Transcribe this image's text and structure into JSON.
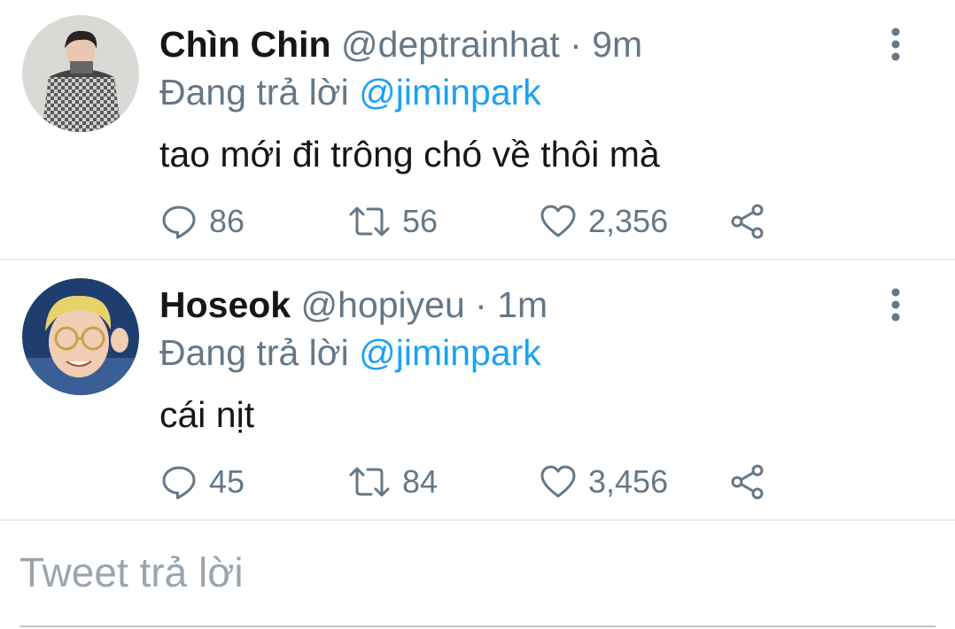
{
  "tweets": [
    {
      "display_name": "Chìn Chin",
      "handle": "@deptrainhat",
      "separator": " · ",
      "time": "9m",
      "replying_prefix": "Đang trả lời ",
      "replying_to": "@jiminpark",
      "text": "tao mới đi trông chó về thôi mà",
      "replies": "86",
      "retweets": "56",
      "likes": "2,356",
      "avatar_colors": {
        "bg": "#d9d9d6",
        "coat": "#3c3c3c",
        "hair": "#2a2220",
        "skin": "#e9c8b2"
      }
    },
    {
      "display_name": "Hoseok",
      "handle": "@hopiyeu",
      "separator": " · ",
      "time": "1m",
      "replying_prefix": "Đang trả lời ",
      "replying_to": "@jiminpark",
      "text": "cái nịt",
      "replies": "45",
      "retweets": "84",
      "likes": "3,456",
      "avatar_colors": {
        "bg": "#1f3d6e",
        "hair": "#e8d36a",
        "skin": "#f0cdb3",
        "glasses": "#c9a24a"
      }
    }
  ],
  "compose": {
    "placeholder": "Tweet trả lời"
  },
  "colors": {
    "text_primary": "#14171a",
    "text_secondary": "#657786",
    "accent": "#1da1f2",
    "divider": "#e6ecf0"
  },
  "icons": {
    "more": "more-vertical-icon",
    "reply": "reply-bubble-icon",
    "retweet": "retweet-icon",
    "like": "heart-icon",
    "share": "share-icon"
  }
}
